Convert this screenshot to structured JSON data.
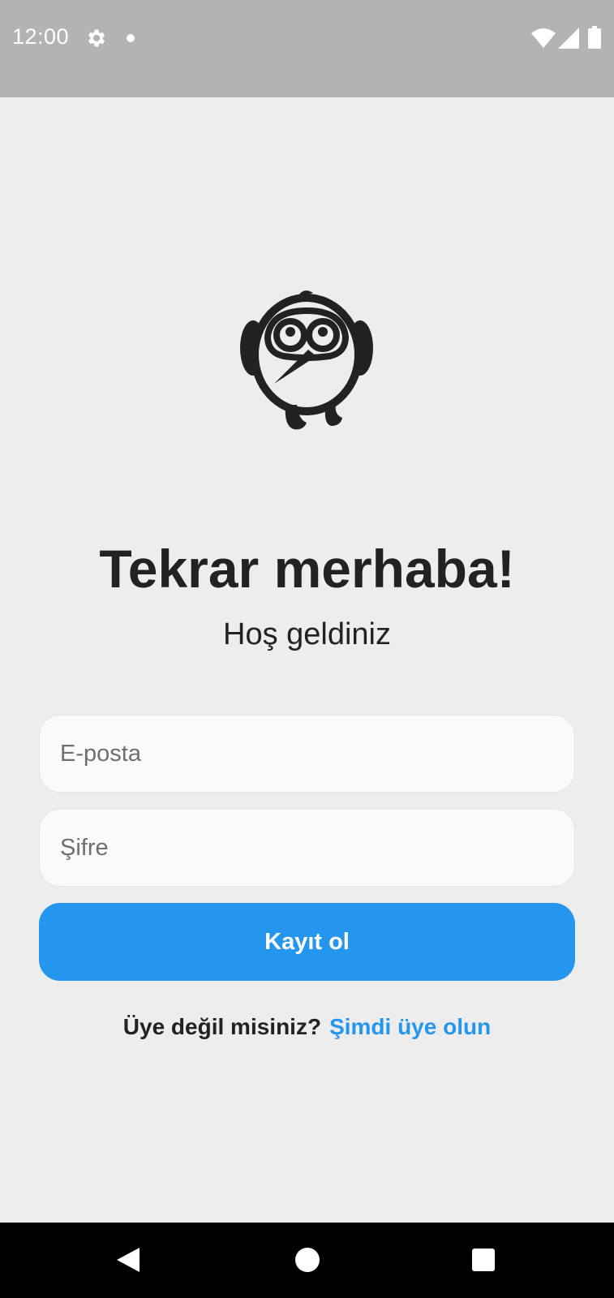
{
  "status_bar": {
    "time": "12:00",
    "icons": [
      "gear-icon",
      "dot-icon",
      "wifi-icon",
      "signal-icon",
      "battery-icon"
    ],
    "background_color": "#b3b3b3"
  },
  "logo": {
    "icon": "bird-logo-icon"
  },
  "header": {
    "title": "Tekrar merhaba!",
    "subtitle": "Hoş geldiniz"
  },
  "form": {
    "email_placeholder": "E-posta",
    "email_value": "",
    "password_placeholder": "Şifre",
    "password_value": "",
    "submit_label": "Kayıt ol"
  },
  "signup": {
    "prompt": "Üye değil misiniz?",
    "link": "Şimdi üye olun"
  },
  "nav_bar": {
    "icons": [
      "back-icon",
      "home-icon",
      "recents-icon"
    ]
  },
  "colors": {
    "accent": "#2596ee",
    "background": "#ededed",
    "text": "#222222"
  }
}
